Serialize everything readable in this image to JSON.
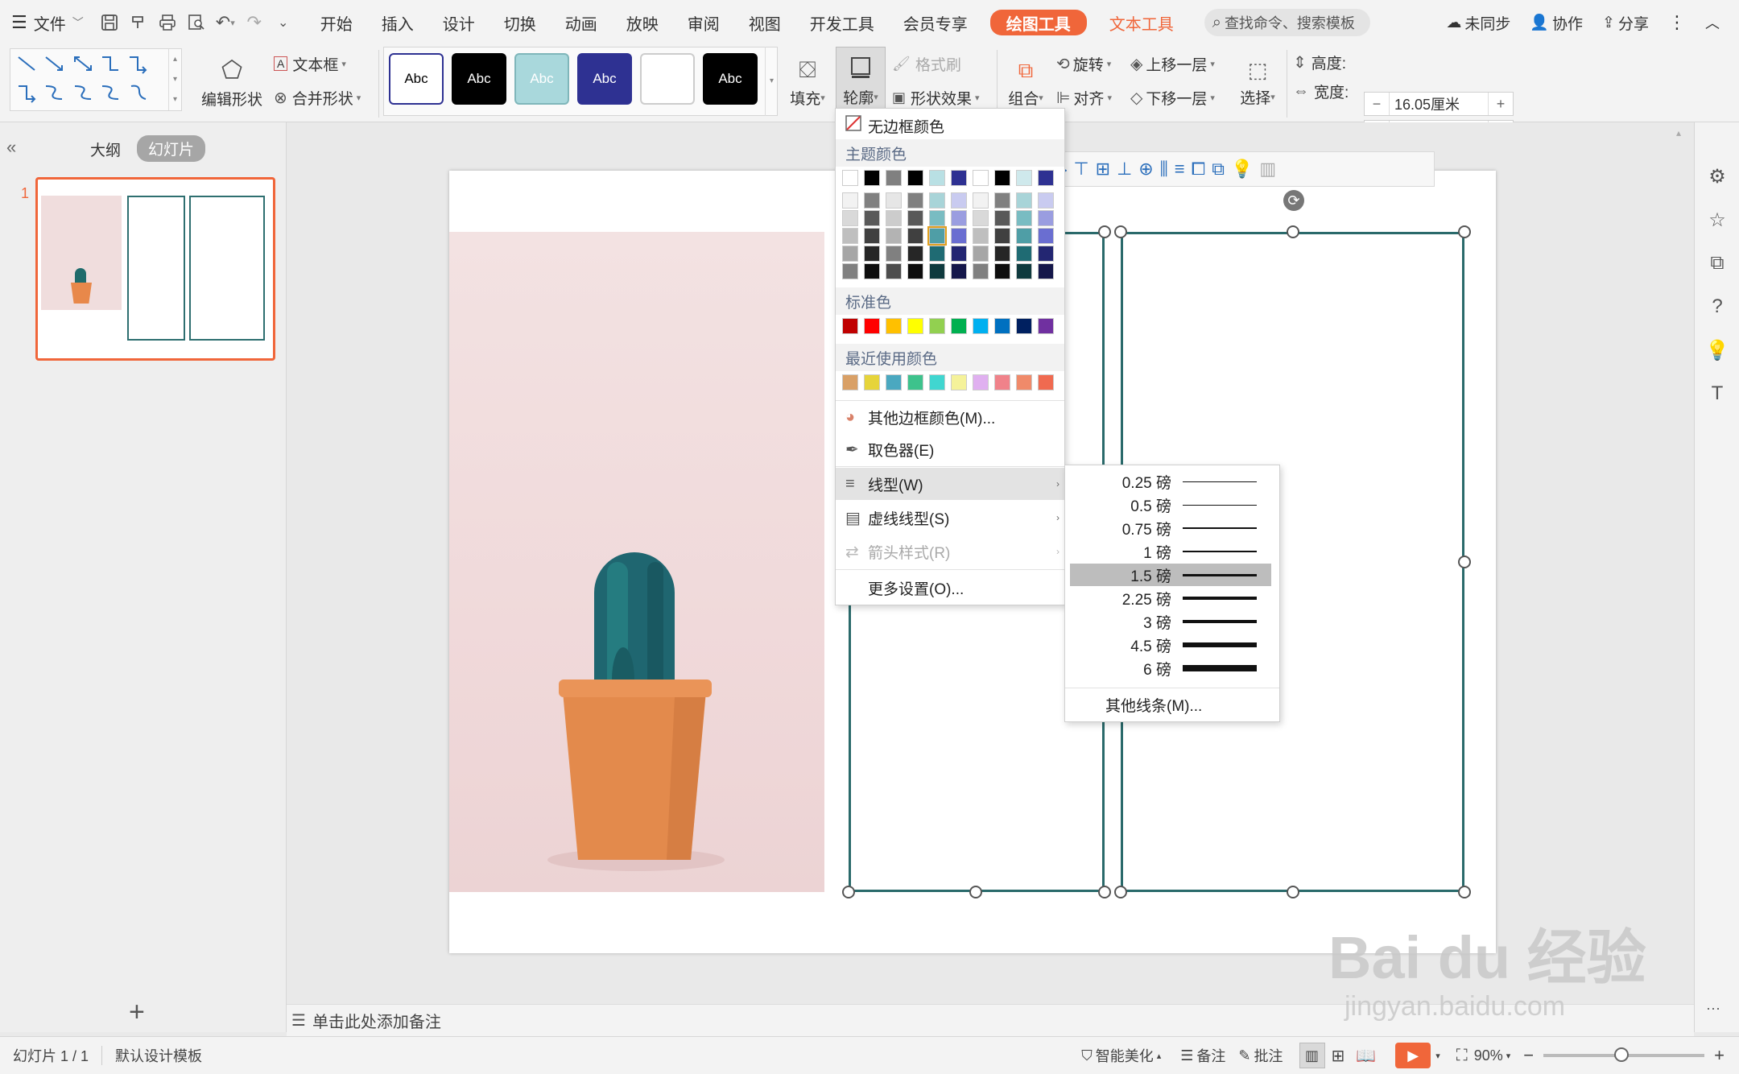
{
  "menu": {
    "file_label": "文件",
    "tabs": [
      "开始",
      "插入",
      "设计",
      "切换",
      "动画",
      "放映",
      "审阅",
      "视图",
      "开发工具",
      "会员专享"
    ],
    "tab_drawing_tools": "绘图工具",
    "tab_text_tools": "文本工具",
    "search_placeholder": "查找命令、搜索模板",
    "sync_label": "未同步",
    "collab_label": "协作",
    "share_label": "分享"
  },
  "ribbon": {
    "edit_shape": "编辑形状",
    "text_box": "文本框",
    "merge_shape": "合并形状",
    "style_presets": [
      {
        "label": "Abc",
        "bg": "#ffffff",
        "fg": "#000000",
        "border": "#2e3192"
      },
      {
        "label": "Abc",
        "bg": "#000000",
        "fg": "#ffffff",
        "border": "#000000"
      },
      {
        "label": "Abc",
        "bg": "#a9d8dc",
        "fg": "#ffffff",
        "border": "#7fb6ba"
      },
      {
        "label": "Abc",
        "bg": "#2e3192",
        "fg": "#ffffff",
        "border": "#2e3192"
      },
      {
        "label": "",
        "bg": "#ffffff",
        "fg": "#000000",
        "border": "#cccccc"
      },
      {
        "label": "Abc",
        "bg": "#000000",
        "fg": "#ffffff",
        "border": "#000000"
      }
    ],
    "fill": "填充",
    "outline": "轮廓",
    "format_painter": "格式刷",
    "shape_effects": "形状效果",
    "group": "组合",
    "rotate": "旋转",
    "align": "对齐",
    "bring_forward": "上移一层",
    "send_backward": "下移一层",
    "select": "选择",
    "height_label": "高度:",
    "height_value": "16.05厘米",
    "width_label": "宽度:",
    "width_value": ""
  },
  "left_panel": {
    "tab_outline": "大纲",
    "tab_slides": "幻灯片",
    "slide_number": "1"
  },
  "dropdown": {
    "no_border": "无边框颜色",
    "theme_colors_title": "主题颜色",
    "theme_top_row": [
      "#ffffff",
      "#000000",
      "#808080",
      "#000000",
      "#b9e0e4",
      "#2e3192",
      "#ffffff",
      "#000000",
      "#cfe9ec",
      "#2e3192"
    ],
    "theme_columns": [
      [
        "#f2f2f2",
        "#d9d9d9",
        "#bfbfbf",
        "#a6a6a6",
        "#808080"
      ],
      [
        "#808080",
        "#595959",
        "#404040",
        "#262626",
        "#0d0d0d"
      ],
      [
        "#e6e6e6",
        "#cccccc",
        "#b3b3b3",
        "#808080",
        "#4d4d4d"
      ],
      [
        "#808080",
        "#595959",
        "#404040",
        "#262626",
        "#0d0d0d"
      ],
      [
        "#a8d4d8",
        "#79bcc2",
        "#4f9ea6",
        "#1f6b73",
        "#0f3a3e"
      ],
      [
        "#c9cbf0",
        "#9a9de0",
        "#6a6ed1",
        "#232672",
        "#15174a"
      ],
      [
        "#f2f2f2",
        "#d9d9d9",
        "#bfbfbf",
        "#a6a6a6",
        "#808080"
      ],
      [
        "#808080",
        "#595959",
        "#404040",
        "#262626",
        "#0d0d0d"
      ],
      [
        "#a8d4d8",
        "#79bcc2",
        "#4f9ea6",
        "#1f6b73",
        "#0f3a3e"
      ],
      [
        "#c9cbf0",
        "#9a9de0",
        "#6a6ed1",
        "#232672",
        "#15174a"
      ]
    ],
    "standard_title": "标准色",
    "standard_colors": [
      "#c00000",
      "#ff0000",
      "#ffc000",
      "#ffff00",
      "#92d050",
      "#00b050",
      "#00b0f0",
      "#0070c0",
      "#002060",
      "#7030a0"
    ],
    "recent_title": "最近使用颜色",
    "recent_colors": [
      "#d9a066",
      "#e6d43a",
      "#4aa8c0",
      "#3dc28c",
      "#40d6d0",
      "#f5f29a",
      "#e0b0f0",
      "#f0828a",
      "#f08a6a",
      "#f06a50"
    ],
    "more_colors": "其他边框颜色(M)...",
    "eyedropper": "取色器(E)",
    "line_type": "线型(W)",
    "dash_type": "虚线线型(S)",
    "arrow_style": "箭头样式(R)",
    "more_settings": "更多设置(O)..."
  },
  "submenu": {
    "widths": [
      "0.25 磅",
      "0.5 磅",
      "0.75 磅",
      "1 磅",
      "1.5 磅",
      "2.25 磅",
      "3 磅",
      "4.5 磅",
      "6 磅"
    ],
    "selected_index": 4,
    "more_lines": "其他线条(M)..."
  },
  "notes_placeholder": "单击此处添加备注",
  "status": {
    "slide_info": "幻灯片 1 / 1",
    "template": "默认设计模板",
    "smart_beautify": "智能美化",
    "notes": "备注",
    "comments": "批注",
    "zoom": "90%"
  },
  "watermark": {
    "brand": "Bai du 经验",
    "url": "jingyan.baidu.com"
  }
}
